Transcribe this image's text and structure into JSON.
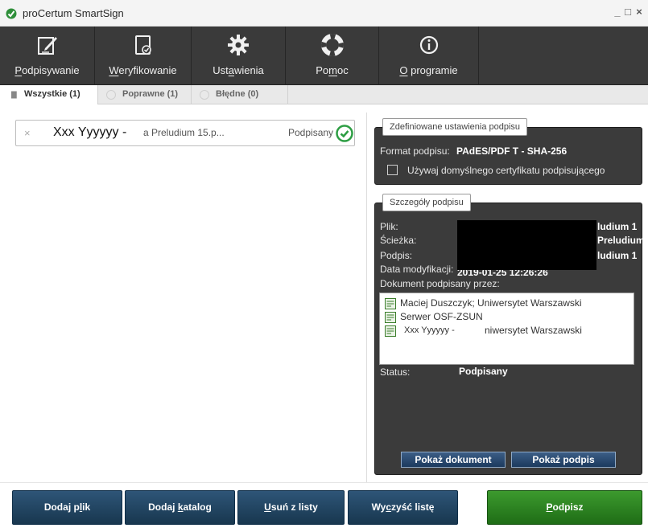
{
  "window": {
    "title": "proCertum SmartSign",
    "minimize_glyph": "_",
    "maximize_glyph": "□",
    "close_glyph": "×"
  },
  "toolbar": {
    "items": [
      {
        "pre": "",
        "ul": "P",
        "post": "odpisywanie",
        "icon": "sign-document-icon"
      },
      {
        "pre": "",
        "ul": "W",
        "post": "eryfikowanie",
        "icon": "verify-document-icon"
      },
      {
        "pre": "Ust",
        "ul": "a",
        "post": "wienia",
        "icon": "gear-icon"
      },
      {
        "pre": "Po",
        "ul": "m",
        "post": "oc",
        "icon": "lifebuoy-icon"
      },
      {
        "pre": "",
        "ul": "O",
        "post": " programie",
        "icon": "info-icon"
      }
    ]
  },
  "tabs": [
    {
      "label": "Wszystkie (1)",
      "active": true
    },
    {
      "label": "Poprawne (1)",
      "active": false
    },
    {
      "label": "Błędne (0)",
      "active": false
    }
  ],
  "file_list": [
    {
      "name": "Xxx Yyyyyy -",
      "file": "a Preludium 15.p...",
      "status": "Podpisany"
    }
  ],
  "settings_panel": {
    "tab_label": "Zdefiniowane ustawienia podpisu",
    "format_label": "Format podpisu:",
    "format_value": "PAdES/PDF T - SHA-256",
    "default_cert_label": "Używaj domyślnego certyfikatu podpisującego",
    "default_cert_checked": false
  },
  "details_panel": {
    "tab_label": "Szczegóły podpisu",
    "file_label": "Plik:",
    "file_value": "ludium 1",
    "path_label": "Ścieżka:",
    "path_value": "Preludium",
    "signature_label": "Podpis:",
    "signature_value": "ludium 1",
    "modified_label": "Data modyfikacji:",
    "modified_value": "2019-01-25 12:26:26",
    "signed_by_label": "Dokument podpisany przez:",
    "signers": [
      "Maciej Duszczyk; Uniwersytet Warszawski",
      "Serwer OSF-ZSUN",
      "Xxx Yyyyyy -",
      "niwersytet Warszawski"
    ],
    "status_label": "Status:",
    "status_value": "Podpisany",
    "show_document_label": "Pokaż dokument",
    "show_signature_label": "Pokaż podpis"
  },
  "bottom_buttons": [
    {
      "pre": "Dodaj p",
      "ul": "l",
      "post": "ik"
    },
    {
      "pre": "Dodaj ",
      "ul": "k",
      "post": "atalog"
    },
    {
      "pre": "",
      "ul": "U",
      "post": "suń z listy"
    },
    {
      "pre": "Wy",
      "ul": "c",
      "post": "zyść listę"
    },
    {
      "pre": "",
      "ul": "P",
      "post": "odpisz"
    }
  ],
  "colors": {
    "toolbar_bg": "#3a3a3a",
    "panel_bg": "#3b3b3b",
    "button_blue": "#1f3f63",
    "button_green": "#2a7d1f",
    "status_ok": "#2e9e44"
  }
}
